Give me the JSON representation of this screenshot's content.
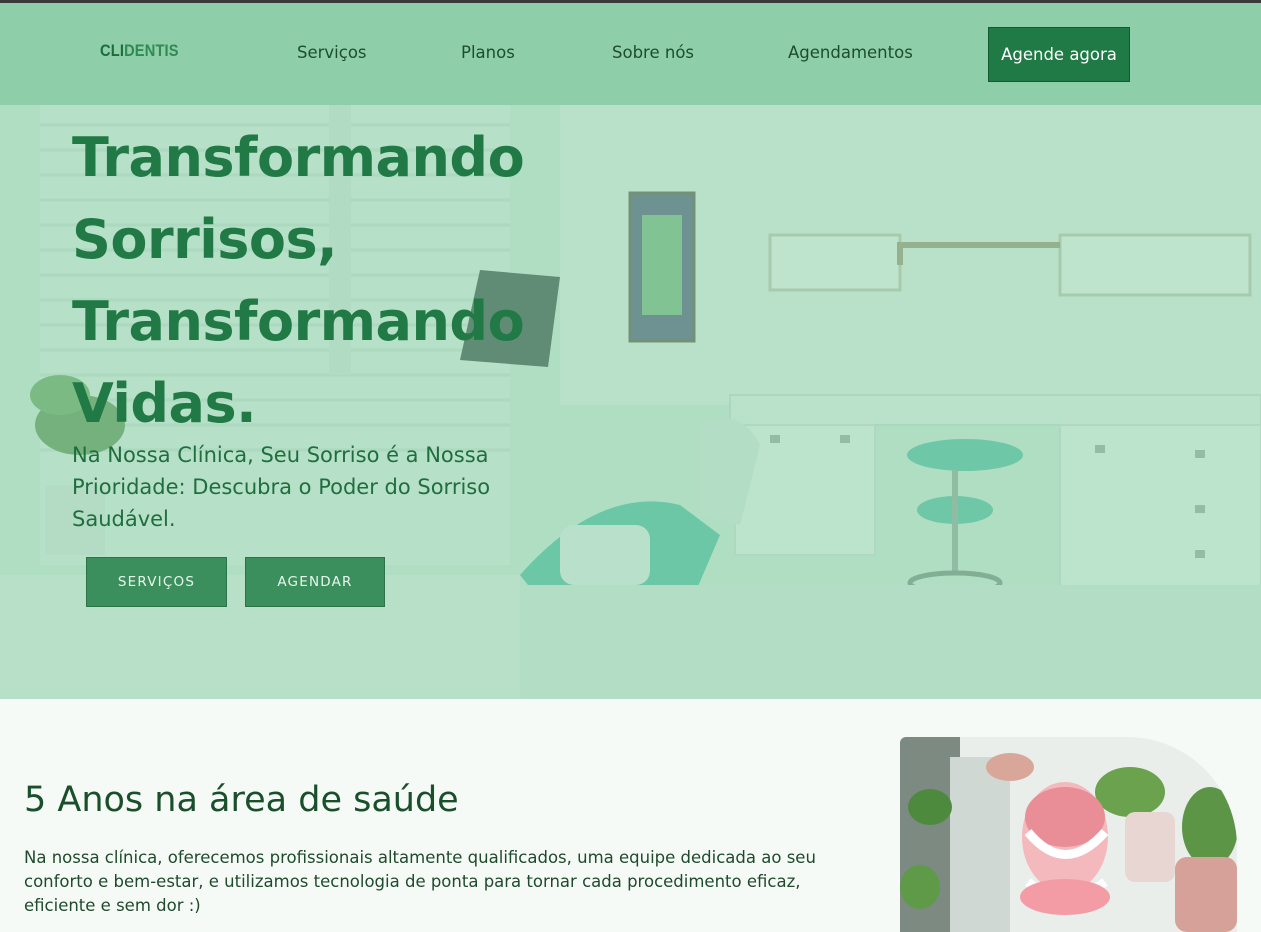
{
  "brand": {
    "logo_part1": "CLI",
    "logo_part2": "DENTIS"
  },
  "nav": {
    "links": [
      "Serviços",
      "Planos",
      "Sobre nós",
      "Agendamentos"
    ],
    "cta_label": "Agende agora"
  },
  "hero": {
    "title": "Transformando Sorrisos, Transformando Vidas.",
    "subtitle": "Na Nossa Clínica, Seu Sorriso é a Nossa Prioridade: Descubra o Poder do Sorriso Saudável.",
    "buttons": [
      "SERVIÇOS",
      "AGENDAR"
    ]
  },
  "about": {
    "title": "5 Anos na área de saúde",
    "text": "Na nossa clínica, oferecemos profissionais altamente qualificados, uma equipe dedicada ao seu conforto e bem-estar, e utilizamos tecnologia de ponta para tornar cada procedimento eficaz, eficiente e sem dor :)"
  },
  "colors": {
    "nav_bg": "#8ecea9",
    "primary": "#1f7a45",
    "hero_button": "#3a8f5c",
    "heading_green": "#217a45"
  }
}
